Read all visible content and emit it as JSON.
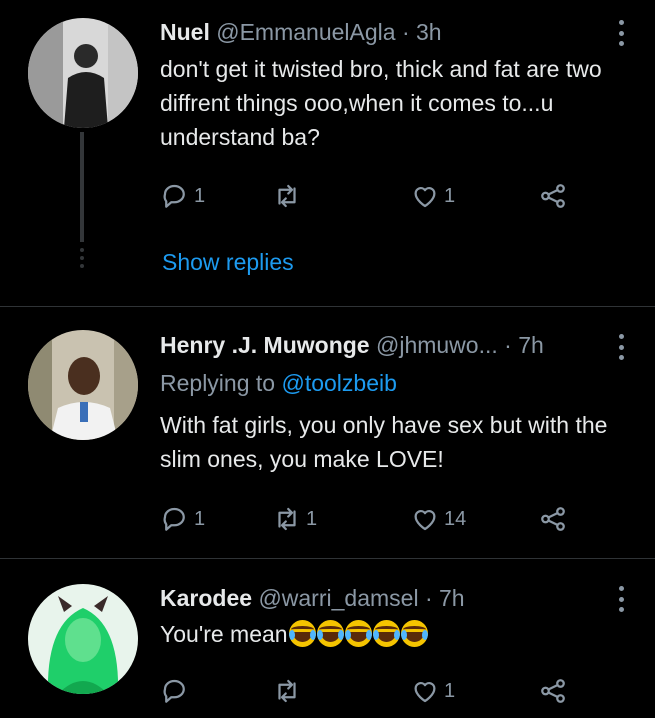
{
  "tweets": [
    {
      "name": "Nuel",
      "handle": "@EmmanuelAgla",
      "separator": "·",
      "time": "3h",
      "text": "don't get it twisted bro, thick and fat are two diffrent things ooo,when it comes to...u understand ba?",
      "replies": "1",
      "retweets": "",
      "likes": "1",
      "show_replies": "Show replies"
    },
    {
      "name": "Henry .J. Muwonge",
      "handle": "@jhmuwo...",
      "separator": "·",
      "time": "7h",
      "replying_prefix": "Replying to",
      "replying_to": "@toolzbeib",
      "text": "With fat girls, you only have sex but with the slim ones, you make LOVE!",
      "replies": "1",
      "retweets": "1",
      "likes": "14"
    },
    {
      "name": "Karodee",
      "handle": "@warri_damsel",
      "separator": "·",
      "time": "7h",
      "text": "You're mean",
      "emoji": "face-with-tears-of-joy",
      "emoji_count": 5,
      "replies": "",
      "retweets": "",
      "likes": "1"
    }
  ],
  "colors": {
    "background": "#000000",
    "text": "#e7e9ea",
    "secondary": "#8b98a5",
    "accent": "#1d9bf0",
    "divider": "#2f3336"
  },
  "icons": [
    "reply-icon",
    "retweet-icon",
    "like-icon",
    "share-icon",
    "more-icon"
  ]
}
